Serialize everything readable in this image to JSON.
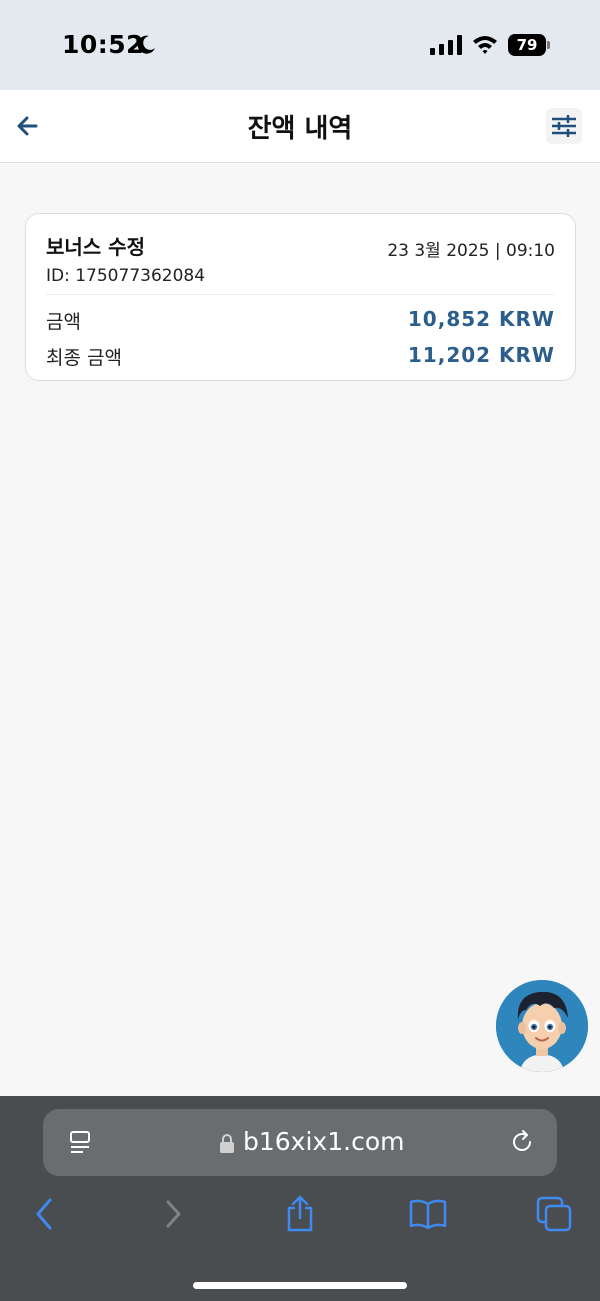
{
  "status_bar": {
    "time": "10:52",
    "battery_level": "79",
    "icons": [
      "moon-icon",
      "signal-icon",
      "wifi-icon",
      "battery-icon"
    ]
  },
  "header": {
    "title": "잔액 내역",
    "back_icon": "arrow-left-icon",
    "filter_icon": "sliders-icon"
  },
  "transaction": {
    "title": "보너스 수정",
    "date": "23 3월 2025 | 09:10",
    "id": "ID: 175077362084",
    "amount_label": "금액",
    "amount_value": "10,852 KRW",
    "final_label": "최종 금액",
    "final_value": "11,202 KRW"
  },
  "browser": {
    "url": "b16xix1.com",
    "icons": [
      "reader-icon",
      "lock-icon",
      "reload-icon",
      "back-icon",
      "forward-icon",
      "share-icon",
      "bookmarks-icon",
      "tabs-icon"
    ]
  },
  "colors": {
    "accent": "#2b5e8c",
    "browser_accent": "#3f8af0",
    "status_bar_bg": "#e3e9ef"
  }
}
